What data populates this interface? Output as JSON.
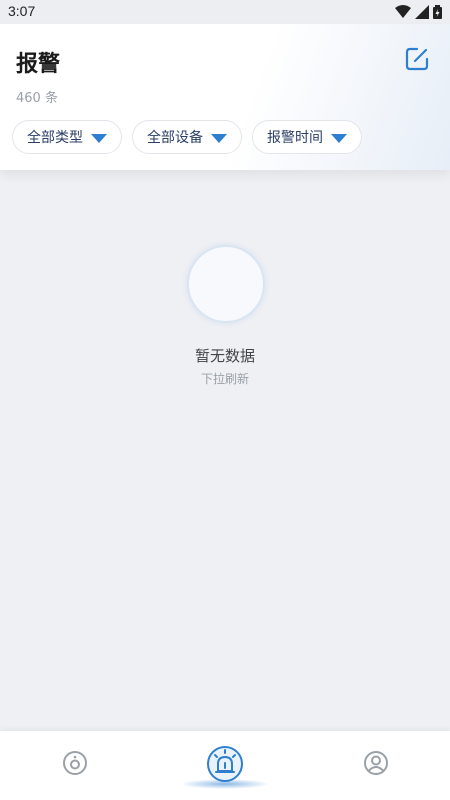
{
  "status_bar": {
    "time": "3:07"
  },
  "header": {
    "title": "报警",
    "count": "460 条"
  },
  "filters": [
    {
      "label": "全部类型"
    },
    {
      "label": "全部设备"
    },
    {
      "label": "报警时间"
    }
  ],
  "empty_state": {
    "title": "暂无数据",
    "hint": "下拉刷新"
  },
  "bottom_nav": {
    "items": [
      {
        "icon": "camera-icon",
        "active": false
      },
      {
        "icon": "siren-alarm-icon",
        "active": true
      },
      {
        "icon": "user-profile-icon",
        "active": false
      }
    ]
  },
  "colors": {
    "accent": "#2f7fd0",
    "inactive_icon": "#9aa0a8"
  }
}
